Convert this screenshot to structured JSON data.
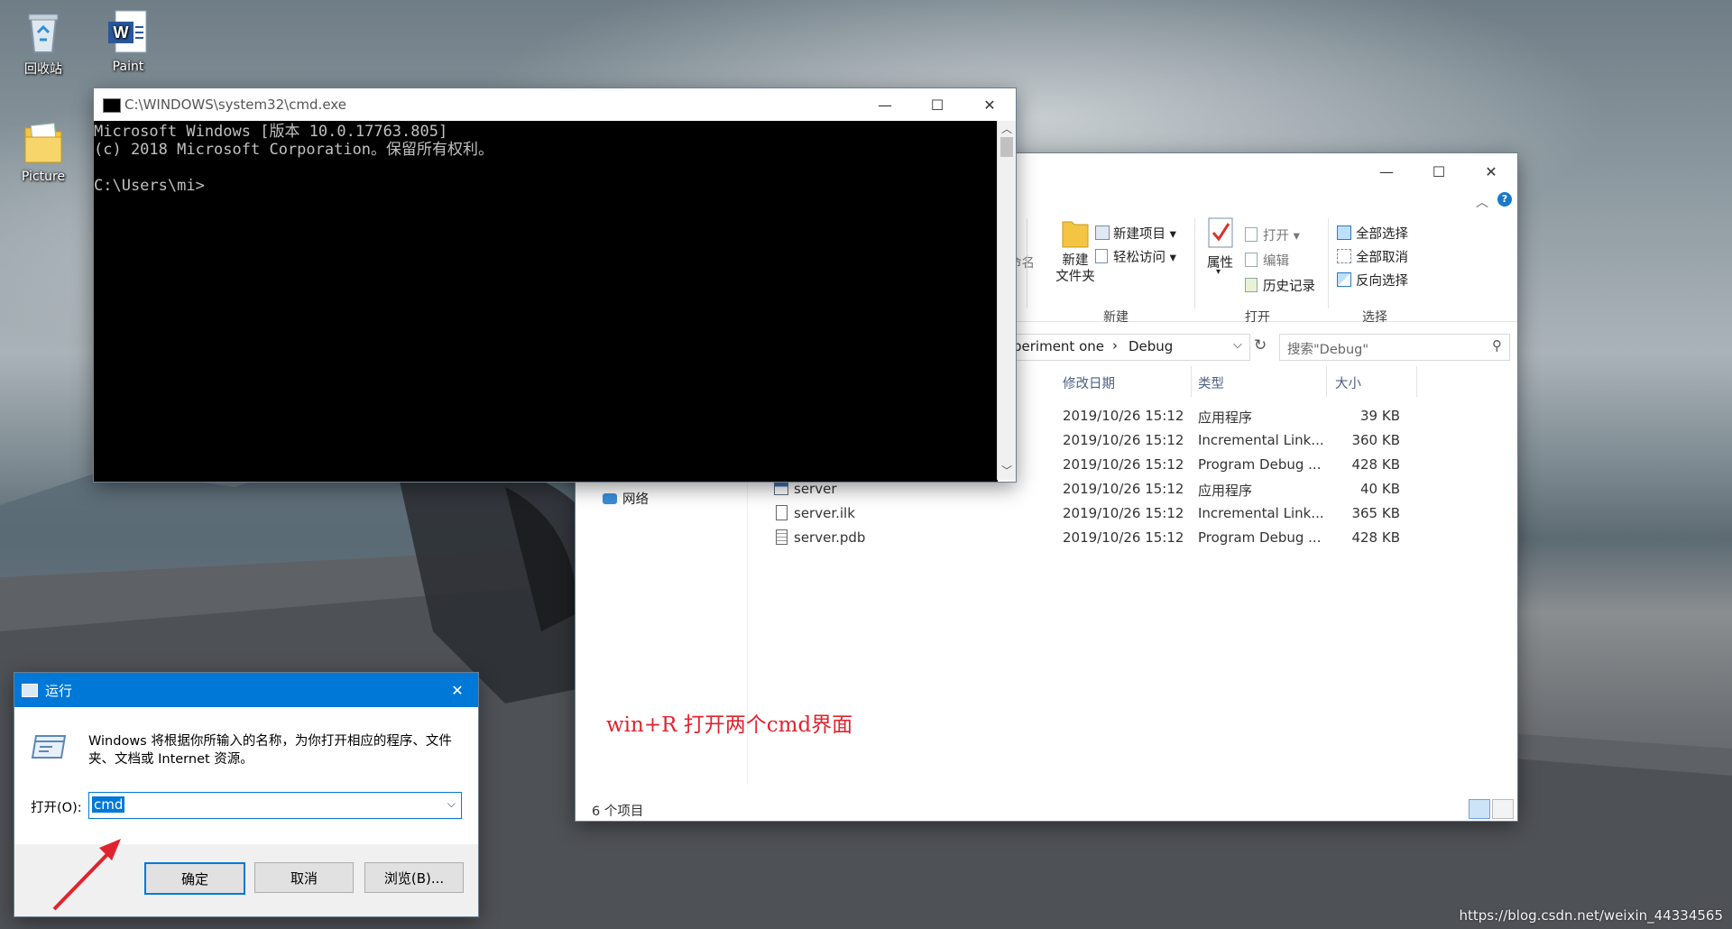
{
  "desktop": {
    "icons": [
      {
        "label": "回收站",
        "icon": "recycle-bin-icon"
      },
      {
        "label": "Paint",
        "icon": "word-doc-icon"
      },
      {
        "label": "Picture",
        "icon": "folder-icon"
      }
    ],
    "watermark": "https://blog.csdn.net/weixin_44334565"
  },
  "cmd": {
    "title": "C:\\WINDOWS\\system32\\cmd.exe",
    "lines": [
      "Microsoft Windows [版本 10.0.17763.805]",
      "(c) 2018 Microsoft Corporation。保留所有权利。",
      "",
      "C:\\Users\\mi>"
    ]
  },
  "explorer": {
    "ribbon": {
      "rename_partial": "命名",
      "new_folder": "新建\n文件夹",
      "new_item": "新建项目",
      "easy_access": "轻松访问",
      "group_new": "新建",
      "properties": "属性",
      "open": "打开",
      "edit": "编辑",
      "history": "历史记录",
      "group_open": "打开",
      "select_all": "全部选择",
      "select_none": "全部取消",
      "invert_selection": "反向选择",
      "group_select": "选择"
    },
    "breadcrumb": {
      "part1": "periment one",
      "sep": "›",
      "part2": "Debug"
    },
    "search_placeholder": "搜索\"Debug\"",
    "columns": {
      "date": "修改日期",
      "type": "类型",
      "size": "大小"
    },
    "nav": {
      "network": "网络"
    },
    "files": [
      {
        "name": "",
        "date": "2019/10/26 15:12",
        "type": "应用程序",
        "size": "39 KB"
      },
      {
        "name": "",
        "date": "2019/10/26 15:12",
        "type": "Incremental Link...",
        "size": "360 KB"
      },
      {
        "name": "",
        "date": "2019/10/26 15:12",
        "type": "Program Debug ...",
        "size": "428 KB"
      },
      {
        "name": "server",
        "date": "2019/10/26 15:12",
        "type": "应用程序",
        "size": "40 KB"
      },
      {
        "name": "server.ilk",
        "date": "2019/10/26 15:12",
        "type": "Incremental Link...",
        "size": "365 KB"
      },
      {
        "name": "server.pdb",
        "date": "2019/10/26 15:12",
        "type": "Program Debug ...",
        "size": "428 KB"
      }
    ],
    "annotation": "win+R 打开两个cmd界面",
    "status": "6 个项目"
  },
  "run": {
    "title": "运行",
    "description": "Windows 将根据你所输入的名称，为你打开相应的程序、文件夹、文档或 Internet 资源。",
    "open_label": "打开(O):",
    "input_value": "cmd",
    "ok": "确定",
    "cancel": "取消",
    "browse": "浏览(B)..."
  },
  "colors": {
    "accent": "#0078d7",
    "annotation": "#e0232e",
    "arrow": "#e0232e"
  }
}
